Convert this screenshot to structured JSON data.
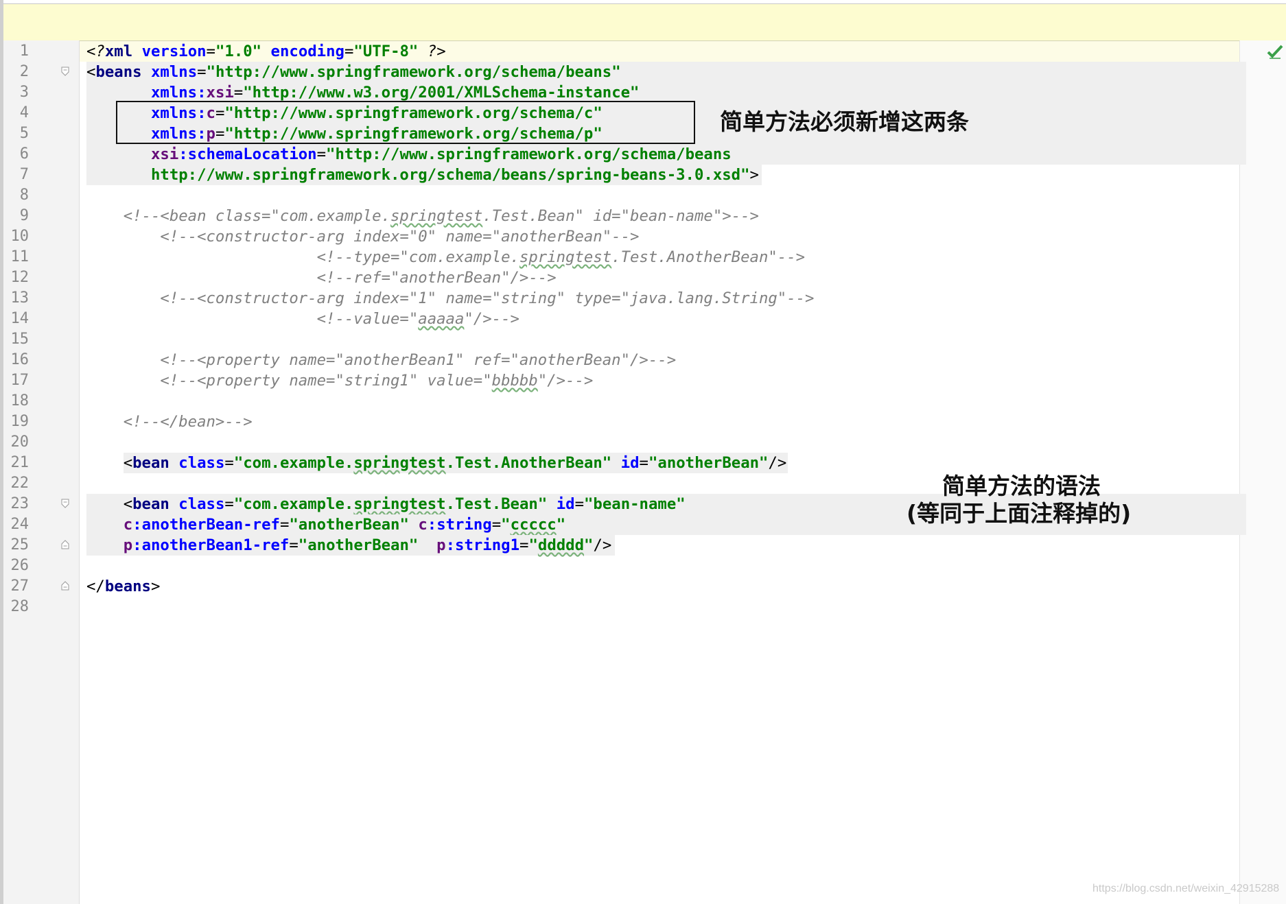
{
  "editor": {
    "lines": [
      {
        "n": "1",
        "active": true,
        "seg": [
          [
            "t-pi",
            "<?"
          ],
          [
            "t-tag",
            "xml"
          ],
          [
            "t-br",
            " "
          ],
          [
            "t-attr",
            "version"
          ],
          [
            "t-br",
            "="
          ],
          [
            "t-val",
            "\"1.0\""
          ],
          [
            "t-br",
            " "
          ],
          [
            "t-attr",
            "encoding"
          ],
          [
            "t-br",
            "="
          ],
          [
            "t-val",
            "\"UTF-8\""
          ],
          [
            "t-br",
            " "
          ],
          [
            "t-pi",
            "?>"
          ]
        ]
      },
      {
        "n": "2",
        "hl": true,
        "fold": "open",
        "seg": [
          [
            "t-br",
            "<"
          ],
          [
            "t-tag",
            "beans"
          ],
          [
            "t-br",
            " "
          ],
          [
            "t-attr",
            "xmlns"
          ],
          [
            "t-br",
            "="
          ],
          [
            "t-val",
            "\"http://www.springframework.org/schema/beans\""
          ]
        ]
      },
      {
        "n": "3",
        "hl": true,
        "seg": [
          [
            "t-br",
            "       "
          ],
          [
            "t-attr",
            "xmlns:"
          ],
          [
            "t-ns",
            "xsi"
          ],
          [
            "t-br",
            "="
          ],
          [
            "t-val",
            "\"http://www.w3.org/2001/XMLSchema-instance\""
          ]
        ]
      },
      {
        "n": "4",
        "hl": true,
        "seg": [
          [
            "t-br",
            "       "
          ],
          [
            "t-attr",
            "xmlns:"
          ],
          [
            "t-ns",
            "c"
          ],
          [
            "t-br",
            "="
          ],
          [
            "t-val",
            "\"http://www.springframework.org/schema/c\""
          ]
        ]
      },
      {
        "n": "5",
        "hl": true,
        "seg": [
          [
            "t-br",
            "       "
          ],
          [
            "t-attr",
            "xmlns:"
          ],
          [
            "t-ns",
            "p"
          ],
          [
            "t-br",
            "="
          ],
          [
            "t-val",
            "\"http://www.springframework.org/schema/p\""
          ]
        ]
      },
      {
        "n": "6",
        "hl": true,
        "seg": [
          [
            "t-br",
            "       "
          ],
          [
            "t-ns",
            "xsi"
          ],
          [
            "t-attr",
            ":schemaLocation"
          ],
          [
            "t-br",
            "="
          ],
          [
            "t-val",
            "\"http://www.springframework.org/schema/beans"
          ]
        ]
      },
      {
        "n": "7",
        "hl": true,
        "seg": [
          [
            "t-br",
            "       "
          ],
          [
            "t-val",
            "http://www.springframework.org/schema/beans/spring-beans-3.0.xsd\""
          ],
          [
            "t-br",
            ">"
          ]
        ]
      },
      {
        "n": "8",
        "seg": []
      },
      {
        "n": "9",
        "seg": [
          [
            "t-cmt",
            "    <!--<bean class=\"com.example."
          ],
          [
            "t-cmt squig",
            "springtest"
          ],
          [
            "t-cmt",
            ".Test.Bean\" id=\"bean-name\">-->"
          ]
        ]
      },
      {
        "n": "10",
        "seg": [
          [
            "t-cmt",
            "        <!--<constructor-arg index=\"0\" name=\"anotherBean\"-->"
          ]
        ]
      },
      {
        "n": "11",
        "seg": [
          [
            "t-cmt",
            "                         <!--type=\"com.example."
          ],
          [
            "t-cmt squig",
            "springtest"
          ],
          [
            "t-cmt",
            ".Test.AnotherBean\"-->"
          ]
        ]
      },
      {
        "n": "12",
        "seg": [
          [
            "t-cmt",
            "                         <!--ref=\"anotherBean\"/>-->"
          ]
        ]
      },
      {
        "n": "13",
        "seg": [
          [
            "t-cmt",
            "        <!--<constructor-arg index=\"1\" name=\"string\" type=\"java.lang.String\"-->"
          ]
        ]
      },
      {
        "n": "14",
        "seg": [
          [
            "t-cmt",
            "                         <!--value=\""
          ],
          [
            "t-cmt squig",
            "aaaaa"
          ],
          [
            "t-cmt",
            "\"/>-->"
          ]
        ]
      },
      {
        "n": "15",
        "seg": []
      },
      {
        "n": "16",
        "seg": [
          [
            "t-cmt",
            "        <!--<property name=\"anotherBean1\" ref=\"anotherBean\"/>-->"
          ]
        ]
      },
      {
        "n": "17",
        "seg": [
          [
            "t-cmt",
            "        <!--<property name=\"string1\" value=\""
          ],
          [
            "t-cmt squig",
            "bbbbb"
          ],
          [
            "t-cmt",
            "\"/>-->"
          ]
        ]
      },
      {
        "n": "18",
        "seg": []
      },
      {
        "n": "19",
        "seg": [
          [
            "t-cmt",
            "    <!--</bean>-->"
          ]
        ]
      },
      {
        "n": "20",
        "seg": []
      },
      {
        "n": "21",
        "seg": [
          [
            "t-br",
            "    <"
          ],
          [
            "t-tag",
            "bean"
          ],
          [
            "t-br",
            " "
          ],
          [
            "t-attr",
            "class"
          ],
          [
            "t-br",
            "="
          ],
          [
            "t-val",
            "\"com.example."
          ],
          [
            "t-val squig",
            "springtest"
          ],
          [
            "t-val",
            ".Test.AnotherBean\""
          ],
          [
            "t-br",
            " "
          ],
          [
            "t-attr",
            "id"
          ],
          [
            "t-br",
            "="
          ],
          [
            "t-val",
            "\"anotherBean\""
          ],
          [
            "t-br",
            "/>"
          ]
        ],
        "hlStart": 4
      },
      {
        "n": "22",
        "seg": []
      },
      {
        "n": "23",
        "hl": true,
        "fold": "open",
        "seg": [
          [
            "t-br",
            "    <"
          ],
          [
            "t-tag",
            "bean"
          ],
          [
            "t-br",
            " "
          ],
          [
            "t-attr",
            "class"
          ],
          [
            "t-br",
            "="
          ],
          [
            "t-val",
            "\"com.example."
          ],
          [
            "t-val squig",
            "springtest"
          ],
          [
            "t-val",
            ".Test.Bean\""
          ],
          [
            "t-br",
            " "
          ],
          [
            "t-attr",
            "id"
          ],
          [
            "t-br",
            "="
          ],
          [
            "t-val",
            "\"bean-name\""
          ]
        ]
      },
      {
        "n": "24",
        "hl": true,
        "seg": [
          [
            "t-br",
            "    "
          ],
          [
            "t-ns",
            "c"
          ],
          [
            "t-attr",
            ":anotherBean-ref"
          ],
          [
            "t-br",
            "="
          ],
          [
            "t-val",
            "\"anotherBean\""
          ],
          [
            "t-br",
            " "
          ],
          [
            "t-ns",
            "c"
          ],
          [
            "t-attr",
            ":string"
          ],
          [
            "t-br",
            "="
          ],
          [
            "t-val",
            "\""
          ],
          [
            "t-val squig",
            "ccccc"
          ],
          [
            "t-val",
            "\""
          ]
        ]
      },
      {
        "n": "25",
        "hl": true,
        "fold": "close",
        "seg": [
          [
            "t-br",
            "    "
          ],
          [
            "t-ns",
            "p"
          ],
          [
            "t-attr",
            ":anotherBean1-ref"
          ],
          [
            "t-br",
            "="
          ],
          [
            "t-val",
            "\"anotherBean\""
          ],
          [
            "t-br",
            "  "
          ],
          [
            "t-ns",
            "p"
          ],
          [
            "t-attr",
            ":string1"
          ],
          [
            "t-br",
            "="
          ],
          [
            "t-val",
            "\""
          ],
          [
            "t-val squig",
            "ddddd"
          ],
          [
            "t-val",
            "\""
          ],
          [
            "t-br",
            "/>"
          ]
        ]
      },
      {
        "n": "26",
        "seg": []
      },
      {
        "n": "27",
        "fold": "close",
        "seg": [
          [
            "t-br",
            "</"
          ],
          [
            "t-tag",
            "beans"
          ],
          [
            "t-br",
            ">"
          ]
        ]
      },
      {
        "n": "28",
        "seg": []
      }
    ]
  },
  "annotations": {
    "namespaces_note": "简单方法必须新增这两条",
    "syntax_note_line1": "简单方法的语法",
    "syntax_note_line2": "(等同于上面注释掉的)"
  },
  "status": {
    "inspection_icon": "check-icon",
    "inspection_color": "#3aa04a"
  },
  "watermark": "https://blog.csdn.net/weixin_42915288"
}
